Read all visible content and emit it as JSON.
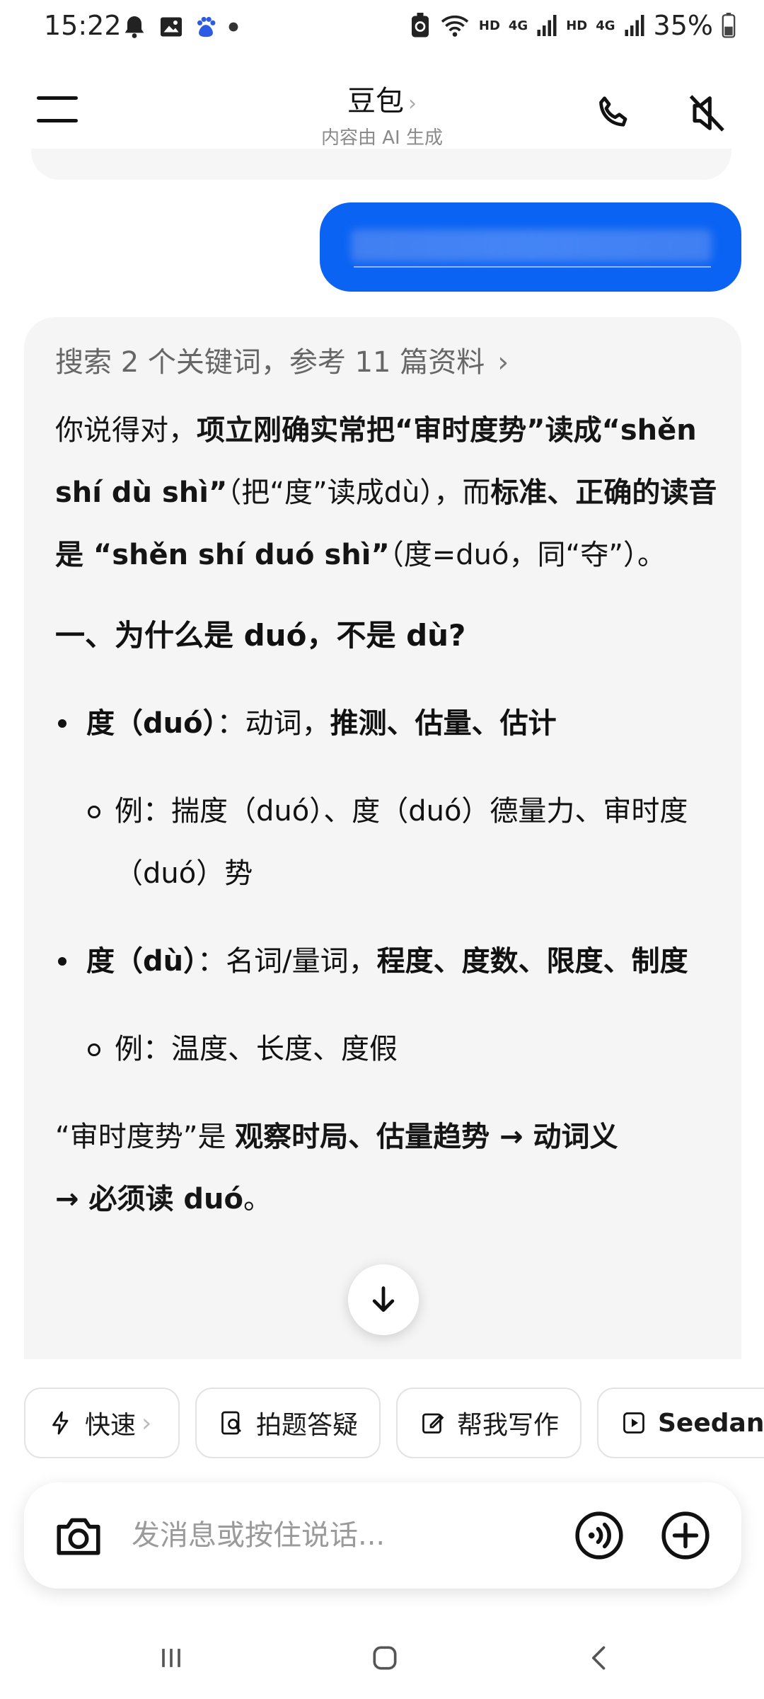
{
  "status_bar": {
    "time": "15:22",
    "battery": "35%",
    "net_hd": "HD",
    "net_4g": "4G"
  },
  "header": {
    "title": "豆包",
    "subtitle": "内容由 AI 生成"
  },
  "answer": {
    "search_summary": "搜索 2 个关键词，参考 11 篇资料",
    "intro": {
      "a": "你说得对，",
      "b": "项立刚确实常把“审时度势”读成“shěn shí dù shì”",
      "c": "（把“度”读成dù），而",
      "d": "标准、正确的读音是 “shěn shí duó shì”",
      "e": "（度=duó，同“夺”）。"
    },
    "section_title": "一、为什么是 duó，不是 dù?",
    "bullets": [
      {
        "head": "度（duó）",
        "colon": "：动词，",
        "meaning": "推测、估量、估计",
        "example": "例：揣度（duó）、度（duó）德量力、审时度（duó）势"
      },
      {
        "head": "度（dù）",
        "colon": "：名词/量词，",
        "meaning": "程度、度数、限度、制度",
        "example": "例：温度、长度、度假"
      }
    ],
    "conclusion": {
      "a": "“审时度势”是 ",
      "b": "观察时局、估量趋势 → 动词义",
      "c": "→ 必须读 duó",
      "d": "。"
    }
  },
  "chips": [
    {
      "label": "快速",
      "icon": "lightning-icon"
    },
    {
      "label": "拍题答疑",
      "icon": "photo-question-icon"
    },
    {
      "label": "帮我写作",
      "icon": "edit-icon"
    },
    {
      "label": "Seedan",
      "icon": "play-icon"
    }
  ],
  "input": {
    "placeholder": "发消息或按住说话..."
  },
  "colors": {
    "accent": "#0a63f3",
    "card_bg": "#f5f5f6"
  }
}
